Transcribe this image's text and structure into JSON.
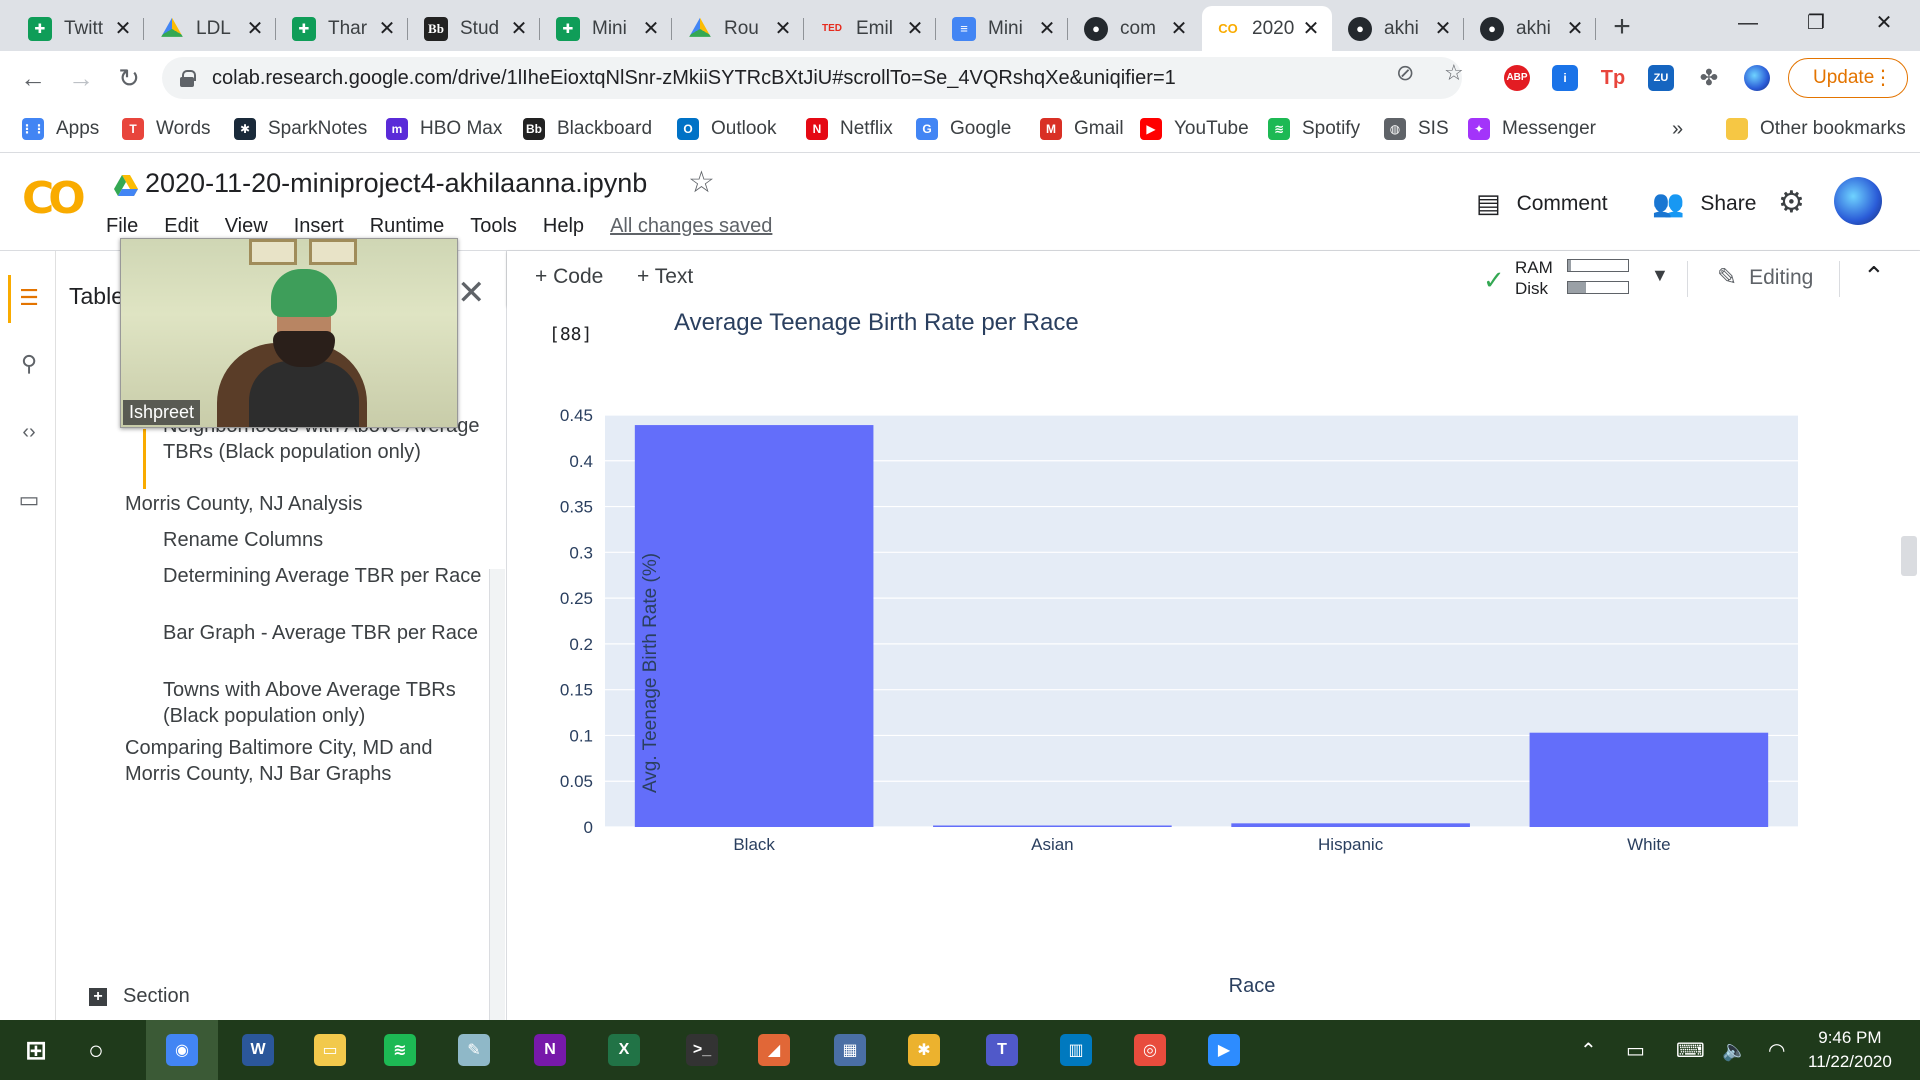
{
  "browser": {
    "tabs": [
      {
        "title": "Twitt",
        "icon": "sheets-icon",
        "fav": "sheets",
        "glyph": "✚"
      },
      {
        "title": "LDL",
        "icon": "drive-icon",
        "fav": "drive",
        "glyph": ""
      },
      {
        "title": "Thar",
        "icon": "sheets-icon",
        "fav": "sheets",
        "glyph": "✚"
      },
      {
        "title": "Stud",
        "icon": "blackboard-icon",
        "fav": "bb",
        "glyph": "Bb"
      },
      {
        "title": "Mini",
        "icon": "sheets-icon",
        "fav": "sheets",
        "glyph": "✚"
      },
      {
        "title": "Rou",
        "icon": "drive-icon",
        "fav": "drive",
        "glyph": ""
      },
      {
        "title": "Emil",
        "icon": "ted-icon",
        "fav": "ted",
        "glyph": "TED"
      },
      {
        "title": "Mini",
        "icon": "docs-icon",
        "fav": "docs",
        "glyph": "≡"
      },
      {
        "title": "com",
        "icon": "github-icon",
        "fav": "gh",
        "glyph": "●"
      },
      {
        "title": "2020",
        "icon": "colab-icon",
        "fav": "co",
        "glyph": "CO"
      },
      {
        "title": "akhi",
        "icon": "github-icon",
        "fav": "gh",
        "glyph": "●"
      },
      {
        "title": "akhi",
        "icon": "github-icon",
        "fav": "gh",
        "glyph": "●"
      }
    ],
    "active_tab_index": 9,
    "url": "colab.research.google.com/drive/1lIheEioxtqNlSnr-zMkiiSYTRcBXtJiU#scrollTo=Se_4VQRshqXe&uniqifier=1",
    "update_label": "Update",
    "bookmarks": [
      {
        "label": "Apps",
        "icon": "apps-grid-icon",
        "color": "#4285f4",
        "glyph": "⋮⋮"
      },
      {
        "label": "Words",
        "icon": "words-icon",
        "color": "#e8453c",
        "glyph": "T"
      },
      {
        "label": "SparkNotes",
        "icon": "sparknotes-icon",
        "color": "#1a2a3a",
        "glyph": "✱"
      },
      {
        "label": "HBO Max",
        "icon": "hbo-max-icon",
        "color": "#5a2bd8",
        "glyph": "m"
      },
      {
        "label": "Blackboard",
        "icon": "blackboard-icon",
        "color": "#222222",
        "glyph": "Bb"
      },
      {
        "label": "Outlook",
        "icon": "outlook-icon",
        "color": "#0072c6",
        "glyph": "O"
      },
      {
        "label": "Netflix",
        "icon": "netflix-icon",
        "color": "#e50914",
        "glyph": "N"
      },
      {
        "label": "Google",
        "icon": "google-icon",
        "color": "#4285f4",
        "glyph": "G"
      },
      {
        "label": "Gmail",
        "icon": "gmail-icon",
        "color": "#d93025",
        "glyph": "M"
      },
      {
        "label": "YouTube",
        "icon": "youtube-icon",
        "color": "#ff0000",
        "glyph": "▶"
      },
      {
        "label": "Spotify",
        "icon": "spotify-icon",
        "color": "#1db954",
        "glyph": "≋"
      },
      {
        "label": "SIS",
        "icon": "globe-icon",
        "color": "#5f6368",
        "glyph": "◍"
      },
      {
        "label": "Messenger",
        "icon": "messenger-icon",
        "color": "#a334fa",
        "glyph": "✦"
      }
    ],
    "other_bookmarks": "Other bookmarks",
    "overflow": "»"
  },
  "colab": {
    "notebook_title": "2020-11-20-miniproject4-akhilaanna.ipynb",
    "menu": [
      "File",
      "Edit",
      "View",
      "Insert",
      "Runtime",
      "Tools",
      "Help"
    ],
    "saved_status": "All changes saved",
    "comment_label": "Comment",
    "share_label": "Share",
    "add_code": "+ Code",
    "add_text": "+ Text",
    "ram_label": "RAM",
    "disk_label": "Disk",
    "ram_usage": 0.05,
    "disk_usage": 0.3,
    "editing_label": "Editing",
    "cell_exec_count": "[88]"
  },
  "toc": {
    "header": "Table",
    "items": [
      {
        "label": "Bar Graph - Average TBR per Race",
        "level": 2,
        "active": true
      },
      {
        "label": "Neighborhoods with Above Average TBRs (Black population only)",
        "level": 2,
        "active": false
      },
      {
        "label": "Morris County, NJ Analysis",
        "level": 1,
        "active": false
      },
      {
        "label": "Rename Columns",
        "level": 2,
        "active": false
      },
      {
        "label": "Determining Average TBR per Race",
        "level": 2,
        "active": false
      },
      {
        "label": "Bar Graph - Average TBR per Race",
        "level": 2,
        "active": false
      },
      {
        "label": "Towns with Above Average TBRs (Black population only)",
        "level": 2,
        "active": false
      },
      {
        "label": "Comparing Baltimore City, MD and Morris County, NJ Bar Graphs",
        "level": 1,
        "active": false
      }
    ],
    "add_section": "Section"
  },
  "video": {
    "participant_name": "Ishpreet"
  },
  "chart_data": {
    "type": "bar",
    "title": "Average Teenage Birth Rate per Race",
    "xlabel": "Race",
    "ylabel": "Avg. Teenage Birth Rate (%)",
    "categories": [
      "Black",
      "Asian",
      "Hispanic",
      "White"
    ],
    "values": [
      0.439,
      0.001,
      0.004,
      0.103
    ],
    "ylim": [
      0,
      0.45
    ],
    "yticks": [
      "0",
      "0.05",
      "0.1",
      "0.15",
      "0.2",
      "0.25",
      "0.3",
      "0.35",
      "0.4",
      "0.45"
    ],
    "bar_color": "#636efa",
    "plot_bg": "#e5ecf6",
    "grid": true
  },
  "taskbar": {
    "apps": [
      {
        "name": "start-button",
        "color": "#ffffff",
        "glyph": "⊞"
      },
      {
        "name": "search-circle",
        "color": "#ffffff",
        "glyph": "○"
      },
      {
        "name": "chrome-app",
        "color": "#4285f4",
        "glyph": "◉"
      },
      {
        "name": "word-app",
        "color": "#2b579a",
        "glyph": "W"
      },
      {
        "name": "file-explorer-app",
        "color": "#f2c94c",
        "glyph": "▭"
      },
      {
        "name": "spotify-app",
        "color": "#1db954",
        "glyph": "≋"
      },
      {
        "name": "notepad-app",
        "color": "#8fb8c8",
        "glyph": "✎"
      },
      {
        "name": "onenote-app",
        "color": "#7719aa",
        "glyph": "N"
      },
      {
        "name": "excel-app",
        "color": "#217346",
        "glyph": "X"
      },
      {
        "name": "terminal-app",
        "color": "#333333",
        "glyph": ">_"
      },
      {
        "name": "matlab-app",
        "color": "#e16737",
        "glyph": "◢"
      },
      {
        "name": "calculator-app",
        "color": "#4a6fa5",
        "glyph": "▦"
      },
      {
        "name": "slack-app",
        "color": "#ecb22e",
        "glyph": "✱"
      },
      {
        "name": "teams-app",
        "color": "#5059c9",
        "glyph": "T"
      },
      {
        "name": "trello-app",
        "color": "#0079bf",
        "glyph": "▥"
      },
      {
        "name": "podcast-app",
        "color": "#e84c3d",
        "glyph": "◎"
      },
      {
        "name": "zoom-app",
        "color": "#2d8cff",
        "glyph": "▶"
      }
    ],
    "time": "9:46 PM",
    "date": "11/22/2020"
  }
}
